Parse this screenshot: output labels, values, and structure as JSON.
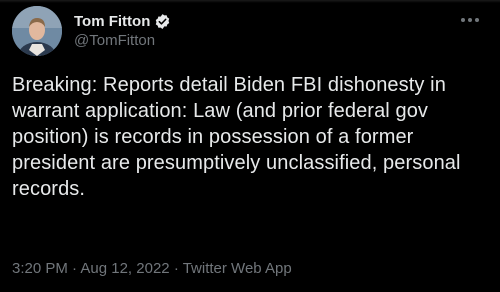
{
  "author": {
    "display_name": "Tom Fitton",
    "handle": "@TomFitton",
    "verified": true
  },
  "tweet": {
    "text": "Breaking: Reports detail Biden FBI dishonesty in warrant application: Law (and prior federal gov position) is records in possession of a former president are presumptively unclassified, personal records.",
    "time": "3:20 PM",
    "date": "Aug 12, 2022",
    "source": "Twitter Web App",
    "separator": "·"
  },
  "icons": {
    "verified": "verified-badge-icon",
    "more": "more-options-icon"
  },
  "colors": {
    "background": "#000000",
    "text": "#e7e9ea",
    "muted": "#71767b",
    "verified_badge": "#e7e9ea"
  }
}
